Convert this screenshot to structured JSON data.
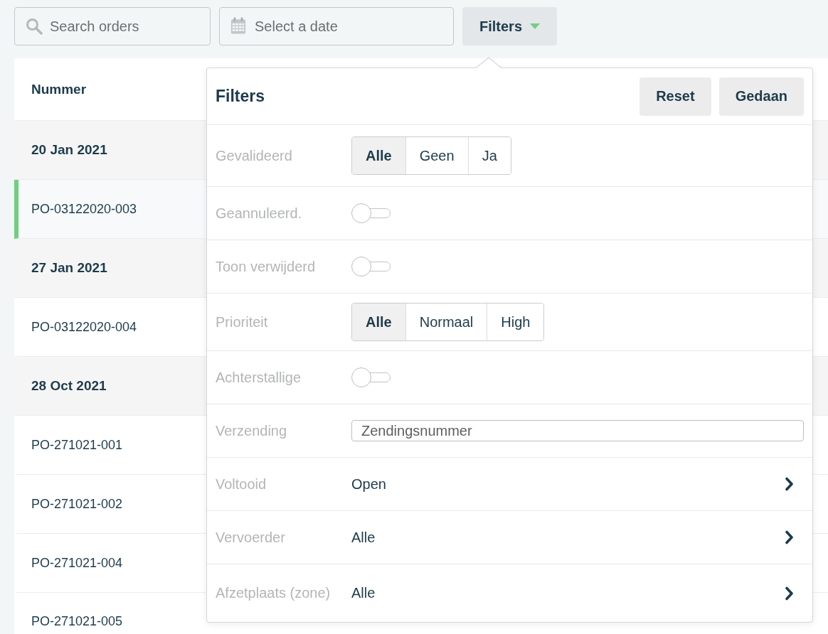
{
  "toolbar": {
    "search": {
      "placeholder": "Search orders"
    },
    "date_picker": {
      "placeholder": "Select a date"
    },
    "filters_button": {
      "label": "Filters",
      "expanded": true
    }
  },
  "table": {
    "columns": [
      "Nummer"
    ],
    "rows": [
      {
        "kind": "group",
        "text": "20 Jan 2021"
      },
      {
        "kind": "order",
        "text": "PO-03122020-003",
        "selected": true
      },
      {
        "kind": "group",
        "text": "27 Jan 2021"
      },
      {
        "kind": "order",
        "text": "PO-03122020-004",
        "selected": false
      },
      {
        "kind": "group",
        "text": "28 Oct 2021"
      },
      {
        "kind": "order",
        "text": "PO-271021-001",
        "selected": false
      },
      {
        "kind": "order",
        "text": "PO-271021-002",
        "selected": false
      },
      {
        "kind": "order",
        "text": "PO-271021-004",
        "selected": false
      },
      {
        "kind": "order",
        "text": "PO-271021-005",
        "selected": false
      }
    ]
  },
  "filters_panel": {
    "title": "Filters",
    "buttons": [
      "Reset",
      "Gedaan"
    ],
    "rows": [
      {
        "kind": "segmented",
        "label": "Gevalideerd",
        "options": [
          {
            "label": "Alle",
            "selected": true
          },
          {
            "label": "Geen",
            "selected": false
          },
          {
            "label": "Ja",
            "selected": false
          }
        ]
      },
      {
        "kind": "toggle",
        "label": "Geannuleerd.",
        "on": false
      },
      {
        "kind": "toggle",
        "label": "Toon verwijderd",
        "on": false
      },
      {
        "kind": "segmented",
        "label": "Prioriteit",
        "options": [
          {
            "label": "Alle",
            "selected": true
          },
          {
            "label": "Normaal",
            "selected": false
          },
          {
            "label": "High",
            "selected": false
          }
        ]
      },
      {
        "kind": "toggle",
        "label": "Achterstallige",
        "on": false
      },
      {
        "kind": "input",
        "label": "Verzending",
        "placeholder": "Zendingsnummer"
      },
      {
        "kind": "select",
        "label": "Voltooid",
        "value": "Open"
      },
      {
        "kind": "select",
        "label": "Vervoerder",
        "value": "Alle"
      },
      {
        "kind": "select",
        "label": "Afzetplaats (zone)",
        "value": "Alle"
      }
    ]
  }
}
